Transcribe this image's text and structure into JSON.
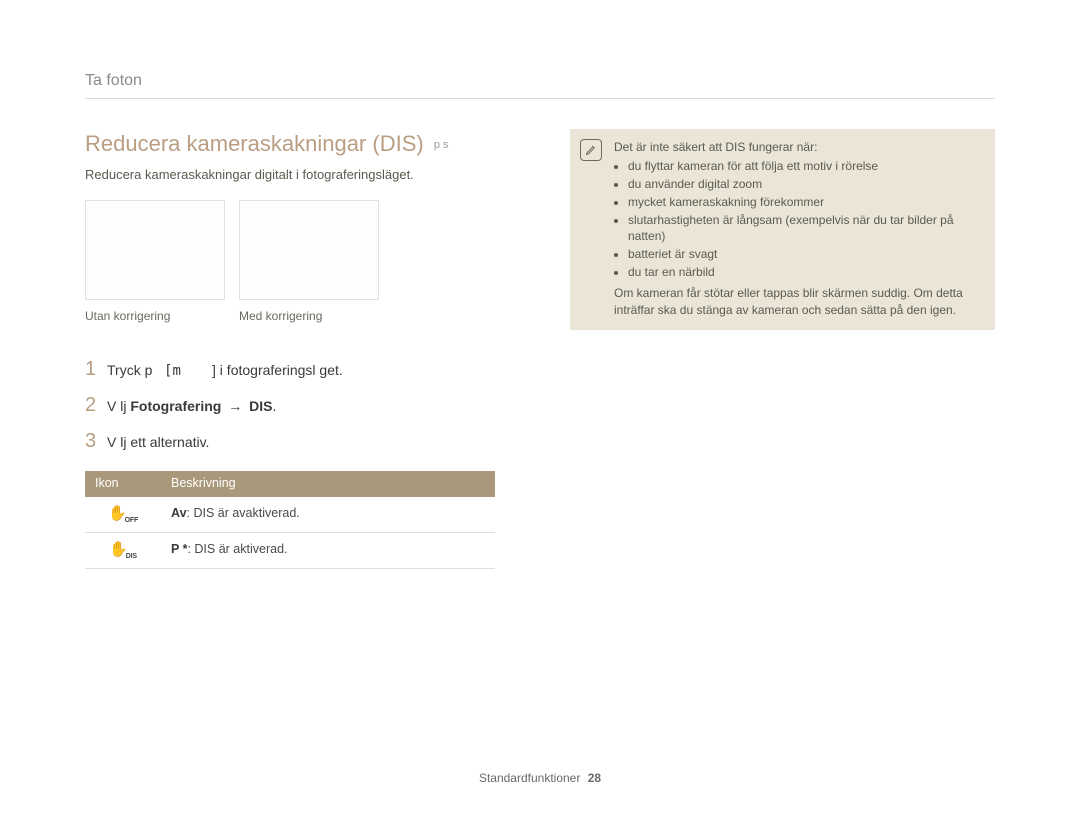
{
  "breadcrumb": "Ta foton",
  "title": "Reducera kameraskakningar (DIS)",
  "title_tag": "p s",
  "subtitle": "Reducera kameraskakningar digitalt i fotograferingsläget.",
  "captions": {
    "left": "Utan korrigering",
    "right": "Med korrigering"
  },
  "steps": [
    {
      "num": "1",
      "pre": "Tryck p",
      "mid": "[m",
      "end": "] i fotograferingsl get."
    },
    {
      "num": "2",
      "text_a": "V lj ",
      "bold": "Fotografering",
      "arrow": "→",
      "text_b": "DIS",
      "tail": "."
    },
    {
      "num": "3",
      "text": "V lj ett alternativ."
    }
  ],
  "table": {
    "headers": {
      "icon": "Ikon",
      "desc": "Beskrivning"
    },
    "rows": [
      {
        "icon_sub": "OFF",
        "bold": "Av",
        "rest": ": DIS är avaktiverad."
      },
      {
        "icon_sub": "DIS",
        "bold": "P *",
        "rest": ": DIS är aktiverad."
      }
    ]
  },
  "note": {
    "lead": "Det är inte säkert att DIS fungerar när:",
    "items": [
      "du flyttar kameran för att följa ett motiv i rörelse",
      "du använder digital zoom",
      "mycket kameraskakning förekommer",
      "slutarhastigheten är långsam (exempelvis när du tar bilder på natten)",
      "batteriet är svagt",
      "du tar en närbild"
    ],
    "tail": "Om kameran får stötar eller tappas blir skärmen suddig. Om detta inträffar ska du stänga av kameran och sedan sätta på den igen."
  },
  "footer": {
    "label": "Standardfunktioner",
    "page": "28"
  }
}
